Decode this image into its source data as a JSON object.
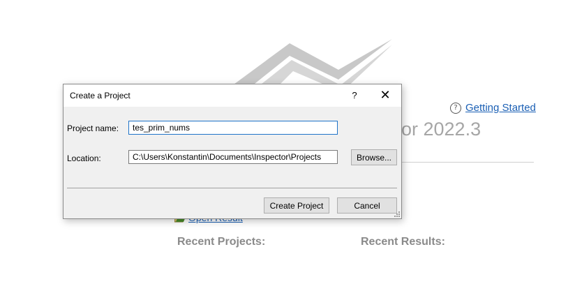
{
  "background": {
    "app_title": "or 2022.3",
    "getting_started_label": "Getting Started",
    "help_icon_glyph": "?",
    "open_result_label": "Open Result",
    "recent_projects_heading": "Recent Projects:",
    "recent_results_heading": "Recent Results:"
  },
  "dialog": {
    "title": "Create a Project",
    "help_glyph": "?",
    "close_glyph": "✕",
    "project_name_label": "Project name:",
    "project_name_value": "tes_prim_nums",
    "location_label": "Location:",
    "location_value": "C:\\Users\\Konstantin\\Documents\\Inspector\\Projects",
    "browse_label": "Browse...",
    "create_label": "Create Project",
    "cancel_label": "Cancel"
  },
  "colors": {
    "link": "#1a5fb4",
    "dialog_bg": "#f0f0f0",
    "focus_border": "#1e73c8",
    "heading_gray": "#8a8a8a"
  }
}
